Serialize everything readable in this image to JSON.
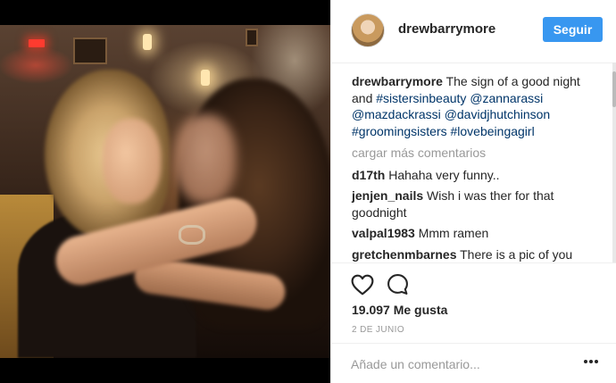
{
  "post": {
    "username": "drewbarrymore",
    "follow_label": "Seguir",
    "caption": {
      "username": "drewbarrymore",
      "text_1": " The sign of a good night and ",
      "tag_1": "#sistersinbeauty",
      "text_2": " ",
      "tag_2": "@zannarassi",
      "text_3": " ",
      "tag_3": "@mazdackrassi",
      "text_4": " ",
      "tag_4": "@davidjhutchinson",
      "text_5": " ",
      "tag_5": "#groomingsisters",
      "text_6": " ",
      "tag_6": "#lovebeingagirl"
    },
    "load_more_label": "cargar más comentarios",
    "comments": [
      {
        "username": "d17th",
        "text": " Hahaha very funny.."
      },
      {
        "username": "jenjen_nails",
        "text": " Wish i was ther for that goodnight"
      },
      {
        "username": "valpal1983",
        "text": " Mmm ramen"
      },
      {
        "username": "gretchenmbarnes",
        "text": " There is a pic of you"
      }
    ],
    "likes": "19.097 Me gusta",
    "date": "2 DE JUNIO",
    "add_comment_placeholder": "Añade un comentario...",
    "icons": {
      "like": "heart-icon",
      "comment": "comment-icon",
      "more": "more-options-icon"
    },
    "colors": {
      "accent": "#3897f0",
      "link": "#003569",
      "muted": "#999999"
    }
  }
}
